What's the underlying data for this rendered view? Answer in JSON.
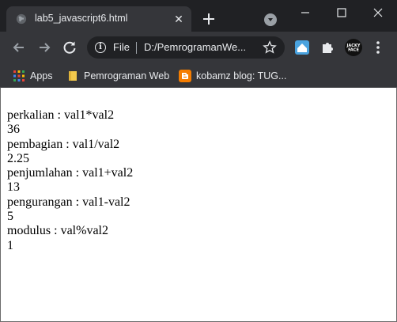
{
  "tab": {
    "title": "lab5_javascript6.html",
    "close_glyph": "✕"
  },
  "omnibox": {
    "scheme": "File",
    "url": "D:/PemrogramanWe..."
  },
  "bookmarks": [
    {
      "label": "Apps",
      "icon": "apps-grid-icon"
    },
    {
      "label": "Pemrograman Web",
      "icon": "folder-icon"
    },
    {
      "label": "kobamz blog: TUG...",
      "icon": "blogger-icon"
    }
  ],
  "profile": {
    "text": "JACKY\nFACE"
  },
  "content": {
    "lines": [
      "perkalian : val1*val2",
      "36",
      "pembagian : val1/val2",
      "2.25",
      "penjumlahan : val1+val2",
      "13",
      "pengurangan : val1-val2",
      "5",
      "modulus : val%val2",
      "1"
    ]
  },
  "colors": {
    "frame": "#202124",
    "toolbar": "#35363a",
    "text_light": "#e8eaed",
    "blogger": "#f57d00",
    "folder": "#f2c94c"
  }
}
